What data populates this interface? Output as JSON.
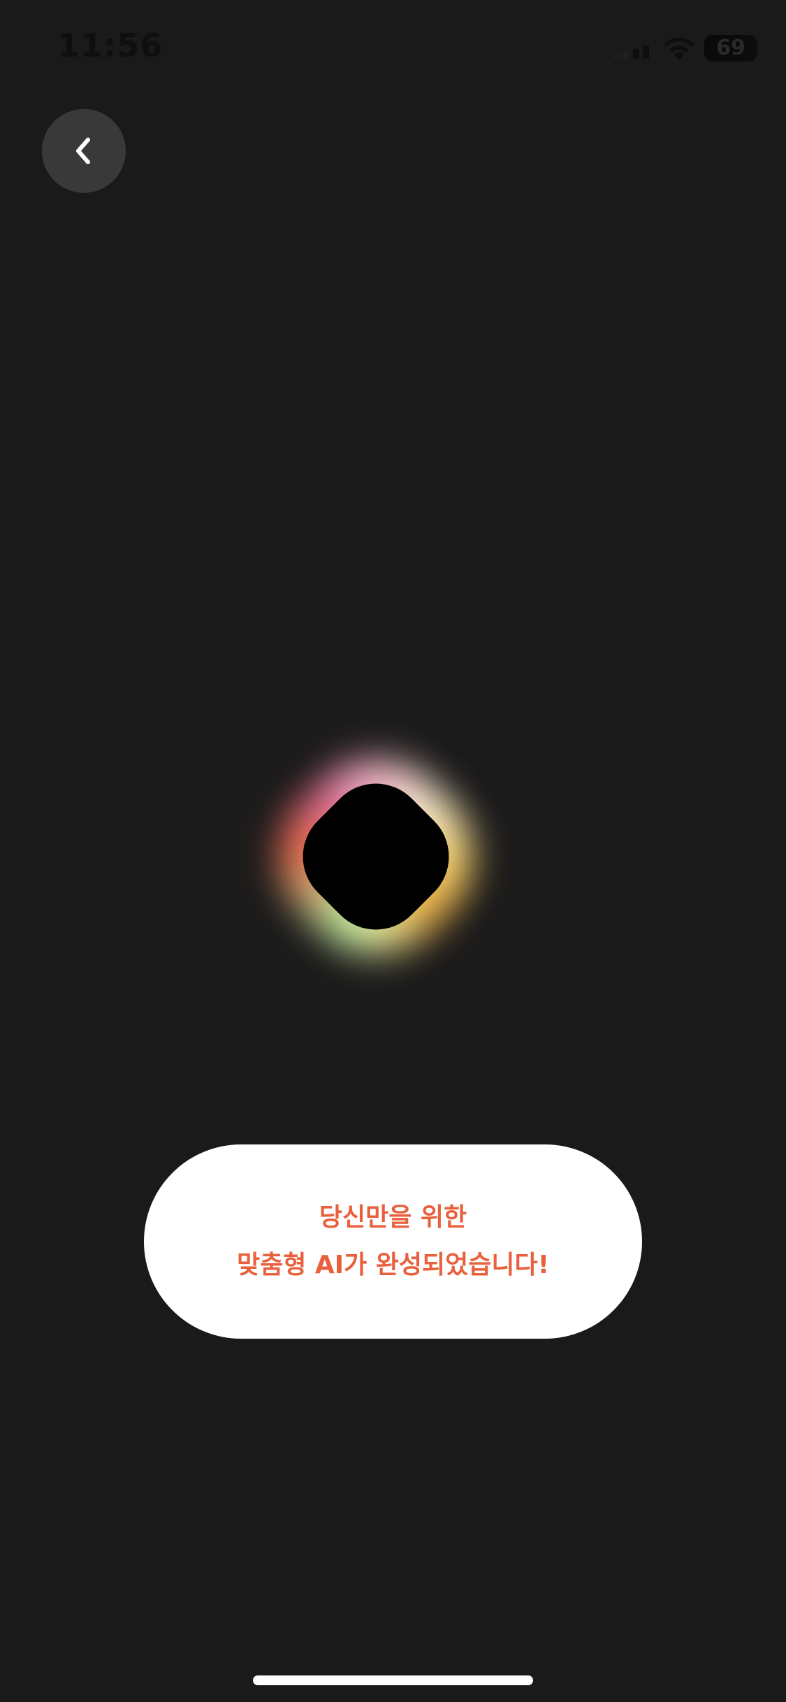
{
  "status_bar": {
    "time": "11:56",
    "battery_level": "69",
    "battery_fraction": 0.69,
    "signal_icon": "cellular-signal-icon",
    "wifi_icon": "wifi-icon",
    "battery_icon": "battery-icon"
  },
  "nav": {
    "back_icon": "chevron-left-icon"
  },
  "message": {
    "line1": "당신만을 위한",
    "line2": "맞춤형 AI가 완성되었습니다!"
  },
  "colors": {
    "background": "#1b1a1a",
    "accent_text": "#e8603c",
    "card": "#ffffff",
    "back_button": "#3a3939",
    "orb_core": "#000000"
  }
}
